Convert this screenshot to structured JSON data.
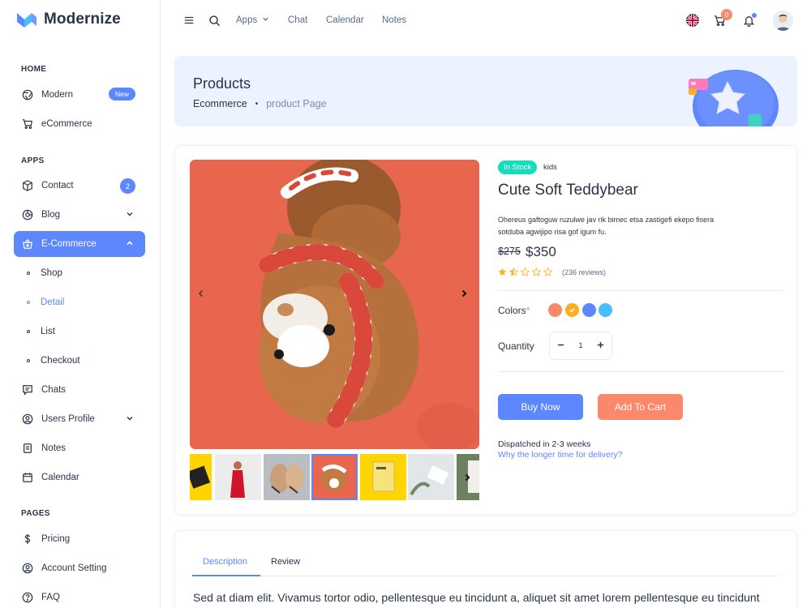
{
  "brand": {
    "name": "Modernize"
  },
  "sidebar": {
    "sections": {
      "home": "HOME",
      "apps": "APPS",
      "pages": "PAGES"
    },
    "home_items": [
      {
        "label": "Modern",
        "icon": "aperture-icon",
        "badge": "New"
      },
      {
        "label": "eCommerce",
        "icon": "cart-icon"
      }
    ],
    "apps_items": [
      {
        "label": "Contact",
        "icon": "box-icon",
        "badge": "2"
      },
      {
        "label": "Blog",
        "icon": "chart-donut-icon"
      },
      {
        "label": "E-Commerce",
        "icon": "basket-icon"
      }
    ],
    "ecommerce_sub": [
      "Shop",
      "Detail",
      "List",
      "Checkout"
    ],
    "more_items": [
      {
        "label": "Chats",
        "icon": "message-icon"
      },
      {
        "label": "Users Profile",
        "icon": "user-circle-icon"
      },
      {
        "label": "Notes",
        "icon": "notes-icon"
      },
      {
        "label": "Calendar",
        "icon": "calendar-icon"
      }
    ],
    "pages_items": [
      {
        "label": "Pricing",
        "icon": "currency-dollar-icon"
      },
      {
        "label": "Account Setting",
        "icon": "user-circle-icon"
      },
      {
        "label": "FAQ",
        "icon": "help-icon"
      }
    ]
  },
  "topbar": {
    "links": [
      "Apps",
      "Chat",
      "Calendar",
      "Notes"
    ],
    "cart_count": "0"
  },
  "breadcrumb": {
    "title": "Products",
    "path": [
      "Ecommerce",
      "product Page"
    ]
  },
  "product": {
    "stock": "In Stock",
    "category": "kids",
    "title": "Cute Soft Teddybear",
    "description": "Ohereus gaftoguw ruzulwe jav rik bimec etsa zastigefi ekepo fisera sotduba agwijipo risa gof igum fu.",
    "old_price": "$275",
    "price": "$350",
    "rating": 1.5,
    "reviews": "(236 reviews)",
    "colors_label": "Colors",
    "required_mark": "*",
    "colors": [
      "#fa896b",
      "#ffae1f",
      "#5d87ff",
      "#49beff"
    ],
    "quantity_label": "Quantity",
    "quantity": "1",
    "buy_label": "Buy Now",
    "cart_label": "Add To Cart",
    "dispatch": "Dispatched in 2-3 weeks",
    "delivery_link": "Why the longer time for delivery?"
  },
  "tabs": {
    "description": "Description",
    "review": "Review"
  },
  "description_text": "Sed at diam elit. Vivamus tortor odio, pellentesque eu tincidunt a, aliquet sit amet lorem pellentesque eu tincidunt"
}
